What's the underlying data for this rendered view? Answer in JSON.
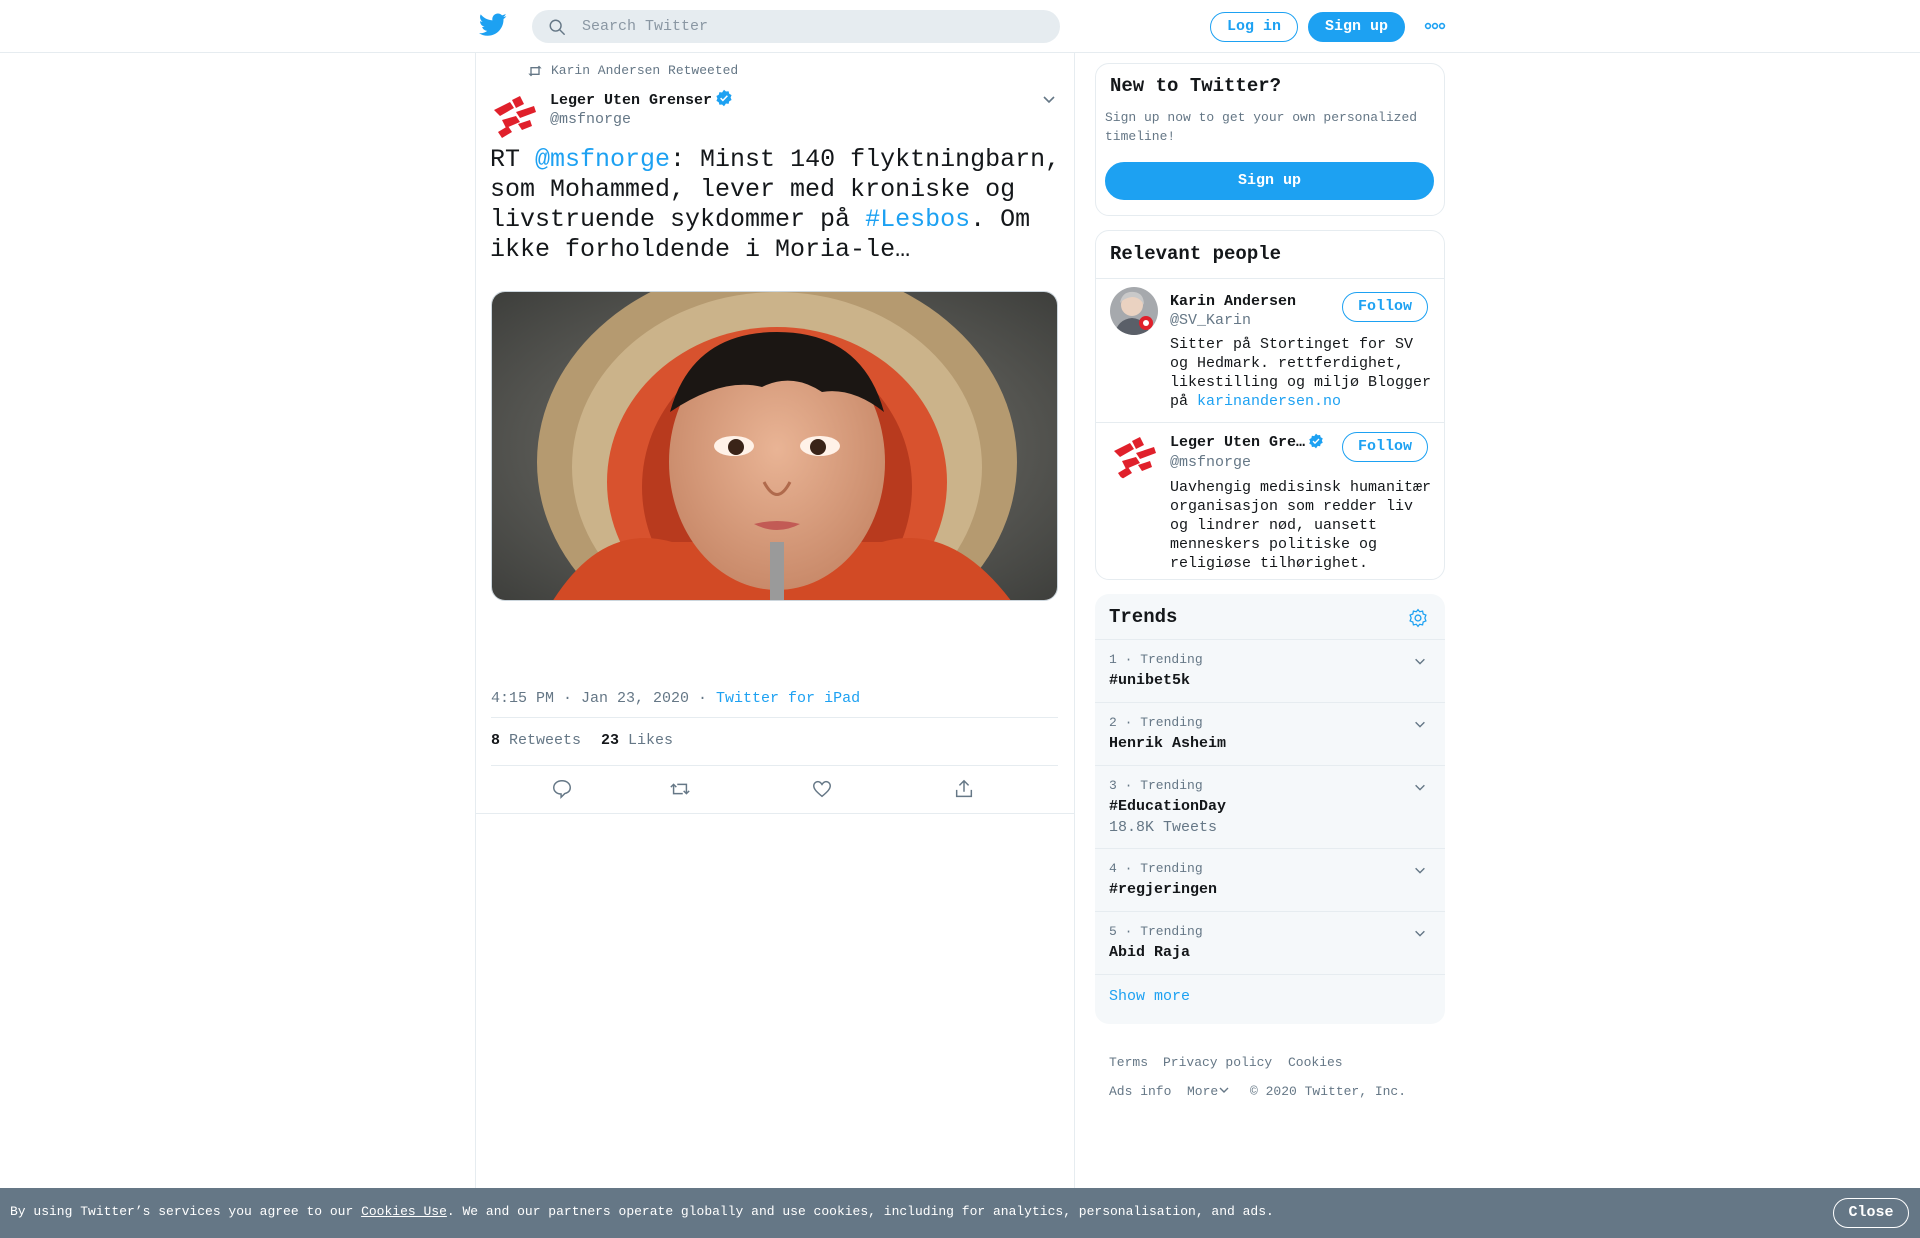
{
  "header": {
    "search_placeholder": "Search Twitter",
    "login_label": "Log in",
    "signup_label": "Sign up",
    "brand_color": "#1da1f2"
  },
  "tweet": {
    "retweeted_by": "Karin Andersen Retweeted",
    "author_name": "Leger Uten Grenser",
    "author_handle": "@msfnorge",
    "text_prefix": "RT ",
    "mention": "@msfnorge",
    "text_mid": ": Minst 140 flyktningbarn, som Mohammed, lever med kroniske og livstruende sykdommer på ",
    "hashtag": "#Lesbos",
    "text_suffix": ". Om ikke forholdende i Moria-le…",
    "time": "4:15 PM · Jan 23, 2020 · ",
    "source": "Twitter for iPad",
    "retweets_count": "8",
    "retweets_label": "Retweets",
    "likes_count": "23",
    "likes_label": "Likes"
  },
  "sidebar": {
    "newto": {
      "title": "New to Twitter?",
      "desc": "Sign up now to get your own personalized timeline!",
      "signup_label": "Sign up"
    },
    "people": {
      "title": "Relevant people",
      "items": [
        {
          "name": "Karin Andersen",
          "handle": "@SV_Karin",
          "bio_text": "Sitter på Stortinget for SV og Hedmark. rettferdighet, likestilling og miljø Blogger på ",
          "bio_link": "karinandersen.no",
          "follow_label": "Follow"
        },
        {
          "name": "Leger Uten Gre…",
          "handle": "@msfnorge",
          "bio_text": "Uavhengig medisinsk humanitær organisasjon som redder liv og lindrer nød, uansett menneskers politiske og religiøse tilhørighet.",
          "follow_label": "Follow"
        }
      ]
    },
    "trends": {
      "title": "Trends",
      "items": [
        {
          "meta": "1 · Trending",
          "name": "#unibet5k",
          "count": ""
        },
        {
          "meta": "2 · Trending",
          "name": "Henrik Asheim",
          "count": ""
        },
        {
          "meta": "3 · Trending",
          "name": "#EducationDay",
          "count": "18.8K Tweets"
        },
        {
          "meta": "4 · Trending",
          "name": "#regjeringen",
          "count": ""
        },
        {
          "meta": "5 · Trending",
          "name": "Abid Raja",
          "count": ""
        }
      ],
      "show_more": "Show more"
    }
  },
  "footer": {
    "terms": "Terms",
    "privacy": "Privacy policy",
    "cookies": "Cookies",
    "ads": "Ads info",
    "more": "More",
    "copyright": "© 2020 Twitter, Inc."
  },
  "cookie_bar": {
    "text_before": "By using Twitter’s services you agree to our ",
    "link": "Cookies Use",
    "text_after": ". We and our partners operate globally and use cookies, including for analytics, personalisation, and ads.",
    "close_label": "Close"
  }
}
